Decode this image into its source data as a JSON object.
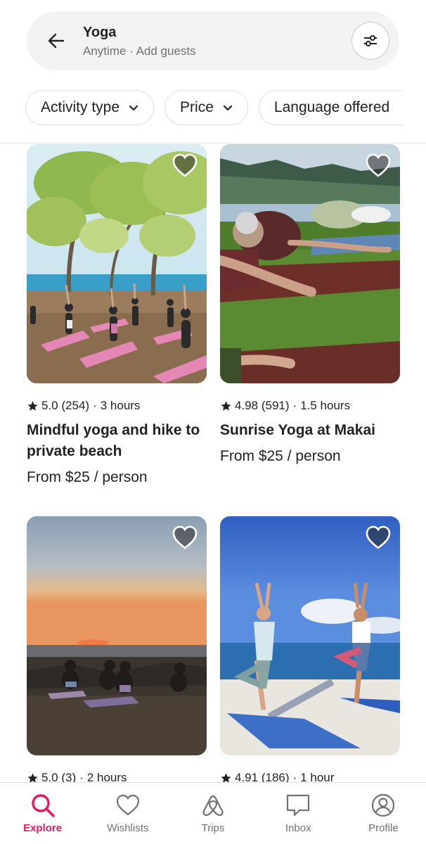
{
  "search": {
    "title": "Yoga",
    "subtitle": "Anytime · Add guests"
  },
  "filters": [
    {
      "label": "Activity type"
    },
    {
      "label": "Price"
    },
    {
      "label": "Language offered"
    }
  ],
  "listings": [
    {
      "rating": "5.0",
      "reviews": "(254)",
      "duration": "3 hours",
      "title": "Mindful yoga and hike to private beach",
      "price": "From $25 / person"
    },
    {
      "rating": "4.98",
      "reviews": "(591)",
      "duration": "1.5 hours",
      "title": "Sunrise Yoga at Makai",
      "price": "From $25 / person"
    },
    {
      "rating": "5.0",
      "reviews": "(3)",
      "duration": "2 hours"
    },
    {
      "rating": "4.91",
      "reviews": "(186)",
      "duration": "1 hour"
    }
  ],
  "meta_separator": "·",
  "nav": [
    {
      "label": "Explore",
      "icon": "search-icon",
      "active": true
    },
    {
      "label": "Wishlists",
      "icon": "heart-icon"
    },
    {
      "label": "Trips",
      "icon": "airbnb-logo-icon"
    },
    {
      "label": "Inbox",
      "icon": "message-icon"
    },
    {
      "label": "Profile",
      "icon": "profile-icon"
    }
  ],
  "colors": {
    "accent": "#e31c5f",
    "text": "#222222",
    "muted": "#717171"
  }
}
